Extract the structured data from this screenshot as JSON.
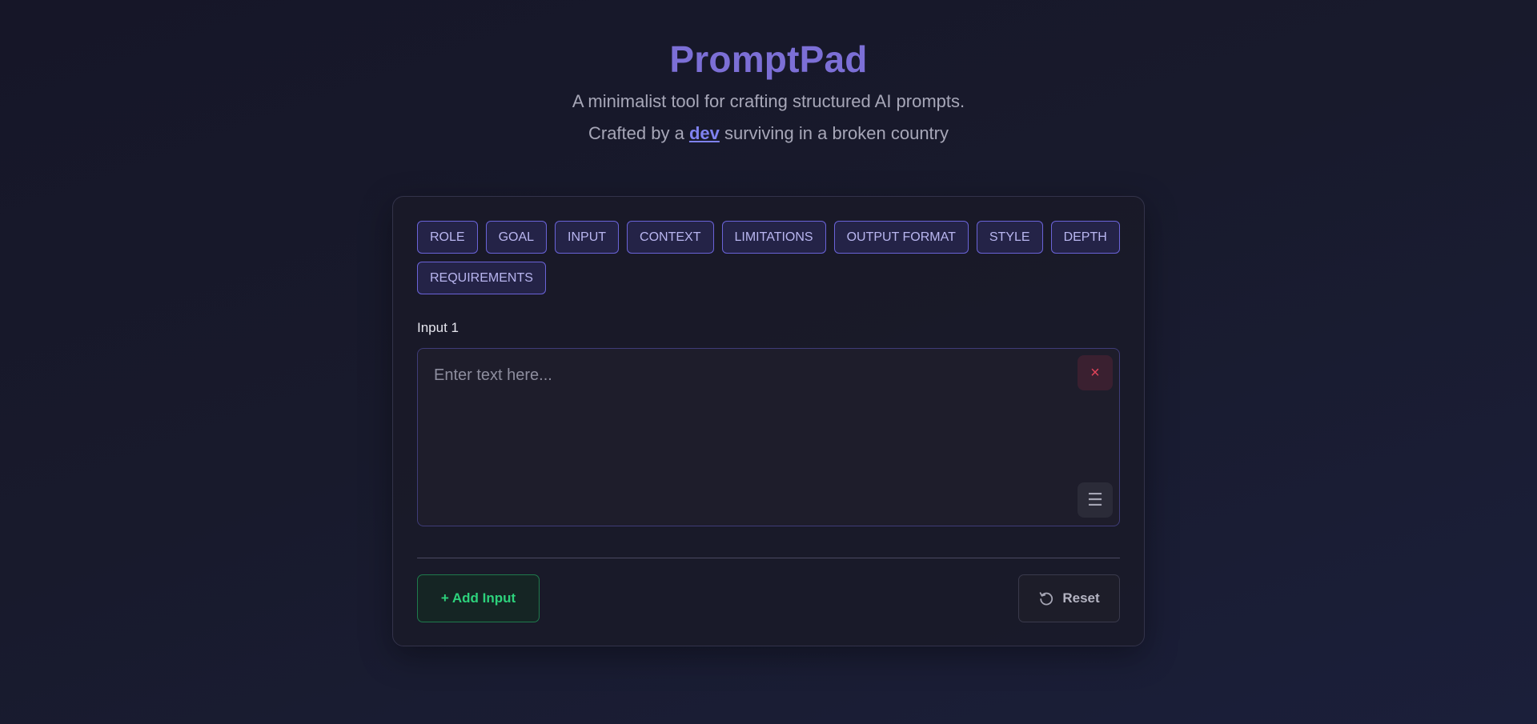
{
  "header": {
    "title": "PromptPad",
    "subtitle": "A minimalist tool for crafting structured AI prompts.",
    "credit_prefix": "Crafted by a ",
    "credit_link": "dev",
    "credit_suffix": " surviving in a broken country"
  },
  "tags": [
    {
      "label": "ROLE"
    },
    {
      "label": "GOAL"
    },
    {
      "label": "INPUT"
    },
    {
      "label": "CONTEXT"
    },
    {
      "label": "LIMITATIONS"
    },
    {
      "label": "OUTPUT FORMAT"
    },
    {
      "label": "STYLE"
    },
    {
      "label": "DEPTH"
    },
    {
      "label": "REQUIREMENTS"
    }
  ],
  "input": {
    "label": "Input 1",
    "value": "",
    "placeholder": "Enter text here...",
    "close_icon": "×",
    "menu_icon": "☰"
  },
  "actions": {
    "add_label": "+ Add Input",
    "reset_label": "Reset"
  },
  "colors": {
    "accent": "#7c6fd6",
    "tag_border": "#6a63d8",
    "add_green": "#2dd27c",
    "close_red": "#e0445a"
  }
}
